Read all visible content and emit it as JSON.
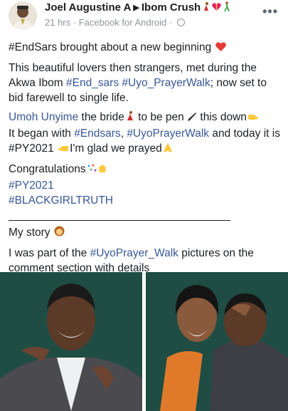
{
  "header": {
    "author": "Joel Augustine A",
    "group": "Ibom Crush",
    "time": "21 hrs",
    "source": "Facebook for Android",
    "more_label": "•••"
  },
  "post": {
    "line1": "#EndSars brought about a new beginning",
    "para2_text": "This beautiful lovers then strangers, met during the Akwa Ibom ",
    "para2_link": "#End_sars #Uyo_PrayerWalk",
    "para2_tail": "; now set to bid farewell to single life.",
    "bride_name": "Umoh Unyime",
    "bride_text1": " the bride",
    "bride_text2": " to be pen ",
    "bride_text3": " this down",
    "began_1": "It began with ",
    "began_link1": "#Endsars",
    "began_comma": ", ",
    "began_link2": "#UyoPrayerWalk",
    "began_2": " and today it is #PY2021 ",
    "began_3": "I'm glad we prayed",
    "congrats": "Congratulations",
    "tag1": "#PY2021",
    "tag2": "#BLACKGIRLTRUTH",
    "my_story": "My story",
    "last_1": "I was part of the ",
    "last_link": "#UyoPrayer_Walk",
    "last_2": " pictures on the comment section with details"
  },
  "colors": {
    "link": "#385898",
    "meta": "#90949c",
    "photo_bg": "#1f4d44"
  }
}
